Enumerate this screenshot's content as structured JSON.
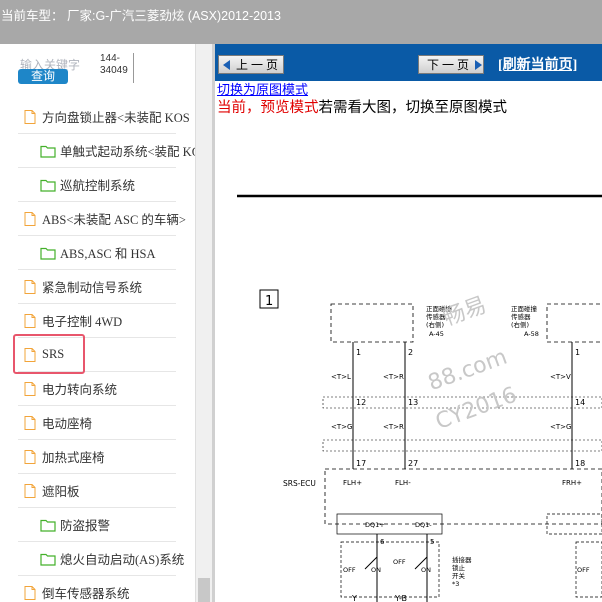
{
  "header": {
    "title": "当前车型：  厂家:G-广汽三菱劲炫 (ASX)2012-2013"
  },
  "search": {
    "label": "输入关键字",
    "button": "查询",
    "code": "144-34049"
  },
  "tree": [
    {
      "label": "方向盘锁止器<未装配 KOS",
      "level": 0,
      "icon": "file-icon"
    },
    {
      "label": "单触式起动系统<装配 KOS",
      "level": 1,
      "icon": "folder-icon"
    },
    {
      "label": "巡航控制系统",
      "level": 1,
      "icon": "folder-icon"
    },
    {
      "label": "ABS<未装配 ASC 的车辆>",
      "level": 0,
      "icon": "file-icon"
    },
    {
      "label": "ABS,ASC 和 HSA",
      "level": 1,
      "icon": "folder-icon"
    },
    {
      "label": "紧急制动信号系统",
      "level": 0,
      "icon": "file-icon"
    },
    {
      "label": "电子控制 4WD",
      "level": 0,
      "icon": "file-icon"
    },
    {
      "label": "SRS",
      "level": 0,
      "icon": "file-icon",
      "highlighted": true
    },
    {
      "label": "电力转向系统",
      "level": 0,
      "icon": "file-icon"
    },
    {
      "label": "电动座椅",
      "level": 0,
      "icon": "file-icon"
    },
    {
      "label": "加热式座椅",
      "level": 0,
      "icon": "file-icon"
    },
    {
      "label": "遮阳板",
      "level": 0,
      "icon": "file-icon"
    },
    {
      "label": "防盗报警",
      "level": 1,
      "icon": "folder-icon"
    },
    {
      "label": "熄火自动启动(AS)系统",
      "level": 1,
      "icon": "folder-icon"
    },
    {
      "label": "倒车传感器系统",
      "level": 0,
      "icon": "file-icon"
    }
  ],
  "nav": {
    "prev": "上 一 页",
    "next": "下 一 页",
    "refresh": "[刷新当前页]"
  },
  "content": {
    "original_link": "切换为原图模式",
    "preview_prefix": "当前，",
    "preview_mode": "预览模式",
    "preview_suffix": "若需看大图，切换至原图模式"
  },
  "diagram": {
    "box_number": "1",
    "sensor_left": [
      "正面碰撞",
      "传感器",
      "(右侧)"
    ],
    "sensor_left_code": "A-45",
    "sensor_right": [
      "正面碰撞",
      "传感器",
      "(右侧)"
    ],
    "sensor_right_code": "A-58",
    "pins_top": [
      "1",
      "2",
      "1"
    ],
    "wire_tags_1": [
      "<T>L",
      "<T>R",
      "<T>V"
    ],
    "pins_mid": [
      "12",
      "13",
      "14"
    ],
    "wire_tags_2": [
      "<T>G",
      "<T>R",
      "<T>G"
    ],
    "pins_ecu": [
      "17",
      "27",
      "18"
    ],
    "ecu_label": "SRS-ECU",
    "ecu_pins": [
      "FLH+",
      "FLH-",
      "FRH+"
    ],
    "dq": [
      "DQ1+",
      "DQ1-"
    ],
    "dq_pins": [
      "6",
      "5"
    ],
    "switch_text": [
      "插接器",
      "锁止",
      "开关",
      "*3"
    ],
    "off_on": [
      "OFF",
      "ON"
    ],
    "bottom_tags": [
      "Y",
      "Y-B"
    ],
    "watermark": [
      "畅易",
      "88.com",
      "CY2016"
    ]
  },
  "colors": {
    "nav_bg": "#0a5aa6",
    "topbar_bg": "#a8a8a8",
    "search_btn": "#1e86c8",
    "highlight": "#e8566c"
  }
}
